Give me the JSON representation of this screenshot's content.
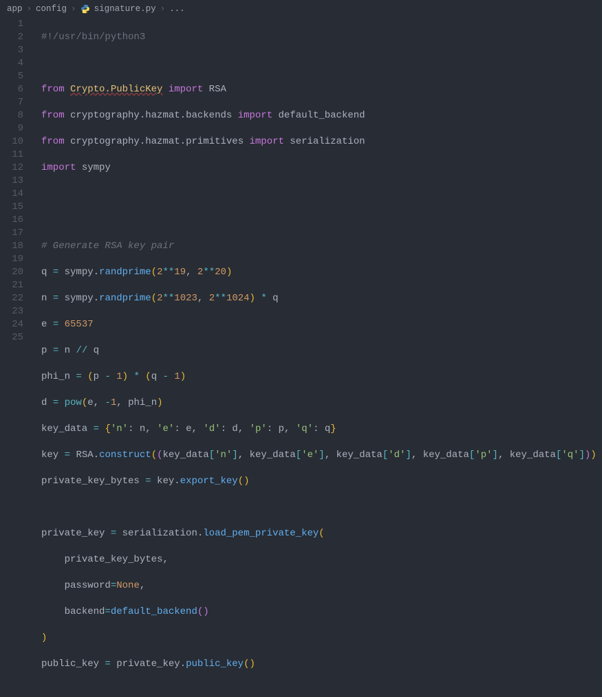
{
  "breadcrumb": {
    "segments": [
      "app",
      "config",
      "signature.py",
      "..."
    ],
    "separator": "›",
    "file_icon": "python-file-icon"
  },
  "file": {
    "name": "signature.py",
    "language": "python"
  },
  "lines": {
    "count": 25,
    "shebang": "#!/usr/bin/python3",
    "l2": "",
    "l3_from": "from",
    "l3_mod": "Crypto.PublicKey",
    "l3_import": "import",
    "l3_name": "RSA",
    "l4_from": "from",
    "l4_mod1": "cryptography",
    "l4_mod2": "hazmat",
    "l4_mod3": "backends",
    "l4_import": "import",
    "l4_name": "default_backend",
    "l5_from": "from",
    "l5_mod1": "cryptography",
    "l5_mod2": "hazmat",
    "l5_mod3": "primitives",
    "l5_import": "import",
    "l5_name": "serialization",
    "l6_import": "import",
    "l6_name": "sympy",
    "l7": "",
    "l8": "",
    "l9_comment": "# Generate RSA key pair",
    "l10_q": "q",
    "l10_eq": "=",
    "l10_sympy": "sympy",
    "l10_rand": "randprime",
    "l10_2a": "2",
    "l10_pow": "**",
    "l10_19": "19",
    "l10_c": ",",
    "l10_2b": "2",
    "l10_20": "20",
    "l11_n": "n",
    "l11_sympy": "sympy",
    "l11_rand": "randprime",
    "l11_2a": "2",
    "l11_1023": "1023",
    "l11_2b": "2",
    "l11_1024": "1024",
    "l11_mul": "*",
    "l11_q": "q",
    "l12_e": "e",
    "l12_eq": "=",
    "l12_val": "65537",
    "l13_p": "p",
    "l13_eq": "=",
    "l13_n": "n",
    "l13_div": "//",
    "l13_q": "q",
    "l14_phi": "phi_n",
    "l14_eq": "=",
    "l14_p": "p",
    "l14_m1a": "1",
    "l14_mul": "*",
    "l14_q": "q",
    "l14_m1b": "1",
    "l15_d": "d",
    "l15_pow": "pow",
    "l15_e": "e",
    "l15_neg1": "-",
    "l15_1": "1",
    "l15_phi": "phi_n",
    "l16_kd": "key_data",
    "l16_eq": "=",
    "l16_kn": "'n'",
    "l16_n": "n",
    "l16_ke": "'e'",
    "l16_e": "e",
    "l16_kd2": "'d'",
    "l16_d": "d",
    "l16_kp": "'p'",
    "l16_p": "p",
    "l16_kq": "'q'",
    "l16_q": "q",
    "l17_key": "key",
    "l17_rsa": "RSA",
    "l17_con": "construct",
    "l17_kd": "key_data",
    "l17_kn": "'n'",
    "l17_ke": "'e'",
    "l17_kdd": "'d'",
    "l17_kp": "'p'",
    "l17_kq": "'q'",
    "l18_pkb": "private_key_bytes",
    "l18_key": "key",
    "l18_exp": "export_key",
    "l19": "",
    "l20_pk": "private_key",
    "l20_ser": "serialization",
    "l20_load": "load_pem_private_key",
    "l21_pkb": "private_key_bytes",
    "l22_pw": "password",
    "l22_none": "None",
    "l23_be": "backend",
    "l23_db": "default_backend",
    "l24_close": ")",
    "l25_pub": "public_key",
    "l25_pk": "private_key",
    "l25_fn": "public_key"
  }
}
